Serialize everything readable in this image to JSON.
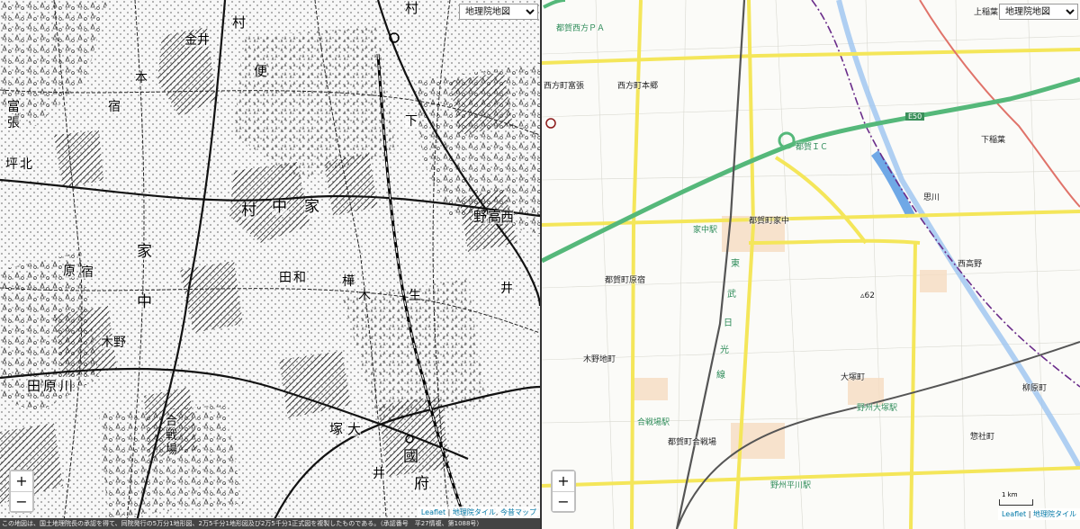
{
  "left_map": {
    "layer_select": "地理院地図",
    "zoom_in": "+",
    "zoom_out": "−",
    "attribution": {
      "leaflet": "Leaflet",
      "sep": "|",
      "gsi_tiles": "地理院タイル",
      "sep2": ",",
      "kon_jaku": "今昔マップ"
    },
    "footer_note": "この地図は、国土地理院長の承認を得て、同院発行の5万分1地形図、2万5千分1地形図及び2万5千分1正式図を複製したものである。（承認番号　平27情複、第1088号）",
    "kanji_labels": [
      {
        "text": "村"
      },
      {
        "text": "便"
      },
      {
        "text": "村"
      },
      {
        "text": "本"
      },
      {
        "text": "宿"
      },
      {
        "text": "金井"
      },
      {
        "text": "下"
      },
      {
        "text": "家"
      },
      {
        "text": "中"
      },
      {
        "text": "村"
      },
      {
        "text": "西"
      },
      {
        "text": "野"
      },
      {
        "text": "高"
      },
      {
        "text": "田"
      },
      {
        "text": "和"
      },
      {
        "text": "樺"
      },
      {
        "text": "木"
      },
      {
        "text": "生"
      },
      {
        "text": "井"
      },
      {
        "text": "家"
      },
      {
        "text": "中"
      },
      {
        "text": "原"
      },
      {
        "text": "宿"
      },
      {
        "text": "木野"
      },
      {
        "text": "田"
      },
      {
        "text": "原"
      },
      {
        "text": "川"
      },
      {
        "text": "合"
      },
      {
        "text": "戦"
      },
      {
        "text": "場"
      },
      {
        "text": "塚"
      },
      {
        "text": "大"
      },
      {
        "text": "國"
      },
      {
        "text": "府"
      },
      {
        "text": "井"
      },
      {
        "text": "富"
      },
      {
        "text": "張"
      },
      {
        "text": "北"
      },
      {
        "text": "坪"
      }
    ]
  },
  "right_map": {
    "layer_select": "地理院地図",
    "zoom_in": "+",
    "zoom_out": "−",
    "attribution": {
      "leaflet": "Leaflet",
      "sep": "|",
      "gsi_tiles": "地理院タイル"
    },
    "scale_label": "1 km",
    "expressway_shield": "E50",
    "spot_height": "▵62",
    "place_labels": [
      {
        "text": "上稲葉",
        "type": "place"
      },
      {
        "text": "都賀西方ＰＡ",
        "type": "station"
      },
      {
        "text": "西方町本郷",
        "type": "place"
      },
      {
        "text": "西方町富張",
        "type": "place"
      },
      {
        "text": "都賀ＩＣ",
        "type": "station"
      },
      {
        "text": "下稲葉",
        "type": "place"
      },
      {
        "text": "思川",
        "type": "place"
      },
      {
        "text": "家中駅",
        "type": "station"
      },
      {
        "text": "都賀町家中",
        "type": "place"
      },
      {
        "text": "西高野",
        "type": "place"
      },
      {
        "text": "都賀町原宿",
        "type": "place"
      },
      {
        "text": "東",
        "type": "rail"
      },
      {
        "text": "武",
        "type": "rail"
      },
      {
        "text": "日",
        "type": "rail"
      },
      {
        "text": "光",
        "type": "rail"
      },
      {
        "text": "線",
        "type": "rail"
      },
      {
        "text": "木野地町",
        "type": "place"
      },
      {
        "text": "大塚町",
        "type": "place"
      },
      {
        "text": "野州大塚駅",
        "type": "station"
      },
      {
        "text": "柳原町",
        "type": "place"
      },
      {
        "text": "合戦場駅",
        "type": "station"
      },
      {
        "text": "都賀町合戦場",
        "type": "place"
      },
      {
        "text": "惣社町",
        "type": "place"
      },
      {
        "text": "野州平川駅",
        "type": "station"
      }
    ]
  }
}
